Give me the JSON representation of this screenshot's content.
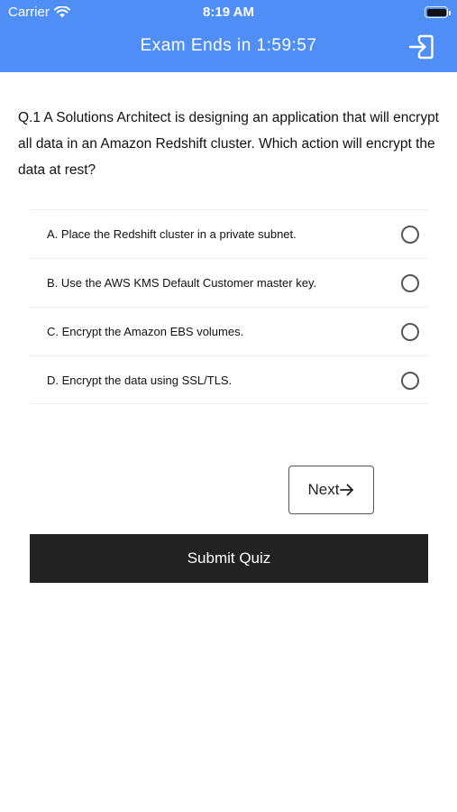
{
  "status_bar": {
    "carrier": "Carrier",
    "time": "8:19 AM"
  },
  "header": {
    "timer_text": "Exam Ends in 1:59:57",
    "background_color": "#4f8ef7",
    "exit_icon": "exit-door-icon"
  },
  "question": {
    "text": "Q.1 A Solutions Architect is designing an application that will encrypt all data in an Amazon Redshift cluster. Which action will encrypt the data at rest?"
  },
  "options": [
    {
      "label": "A. Place the Redshift cluster in a private subnet.",
      "selected": false
    },
    {
      "label": "B. Use the AWS KMS Default Customer master key.",
      "selected": false
    },
    {
      "label": "C. Encrypt the Amazon EBS volumes.",
      "selected": false
    },
    {
      "label": "D. Encrypt the data using SSL/TLS.",
      "selected": false
    }
  ],
  "buttons": {
    "next_label": "Next",
    "next_icon": "arrow-right-icon",
    "submit_label": "Submit Quiz"
  }
}
